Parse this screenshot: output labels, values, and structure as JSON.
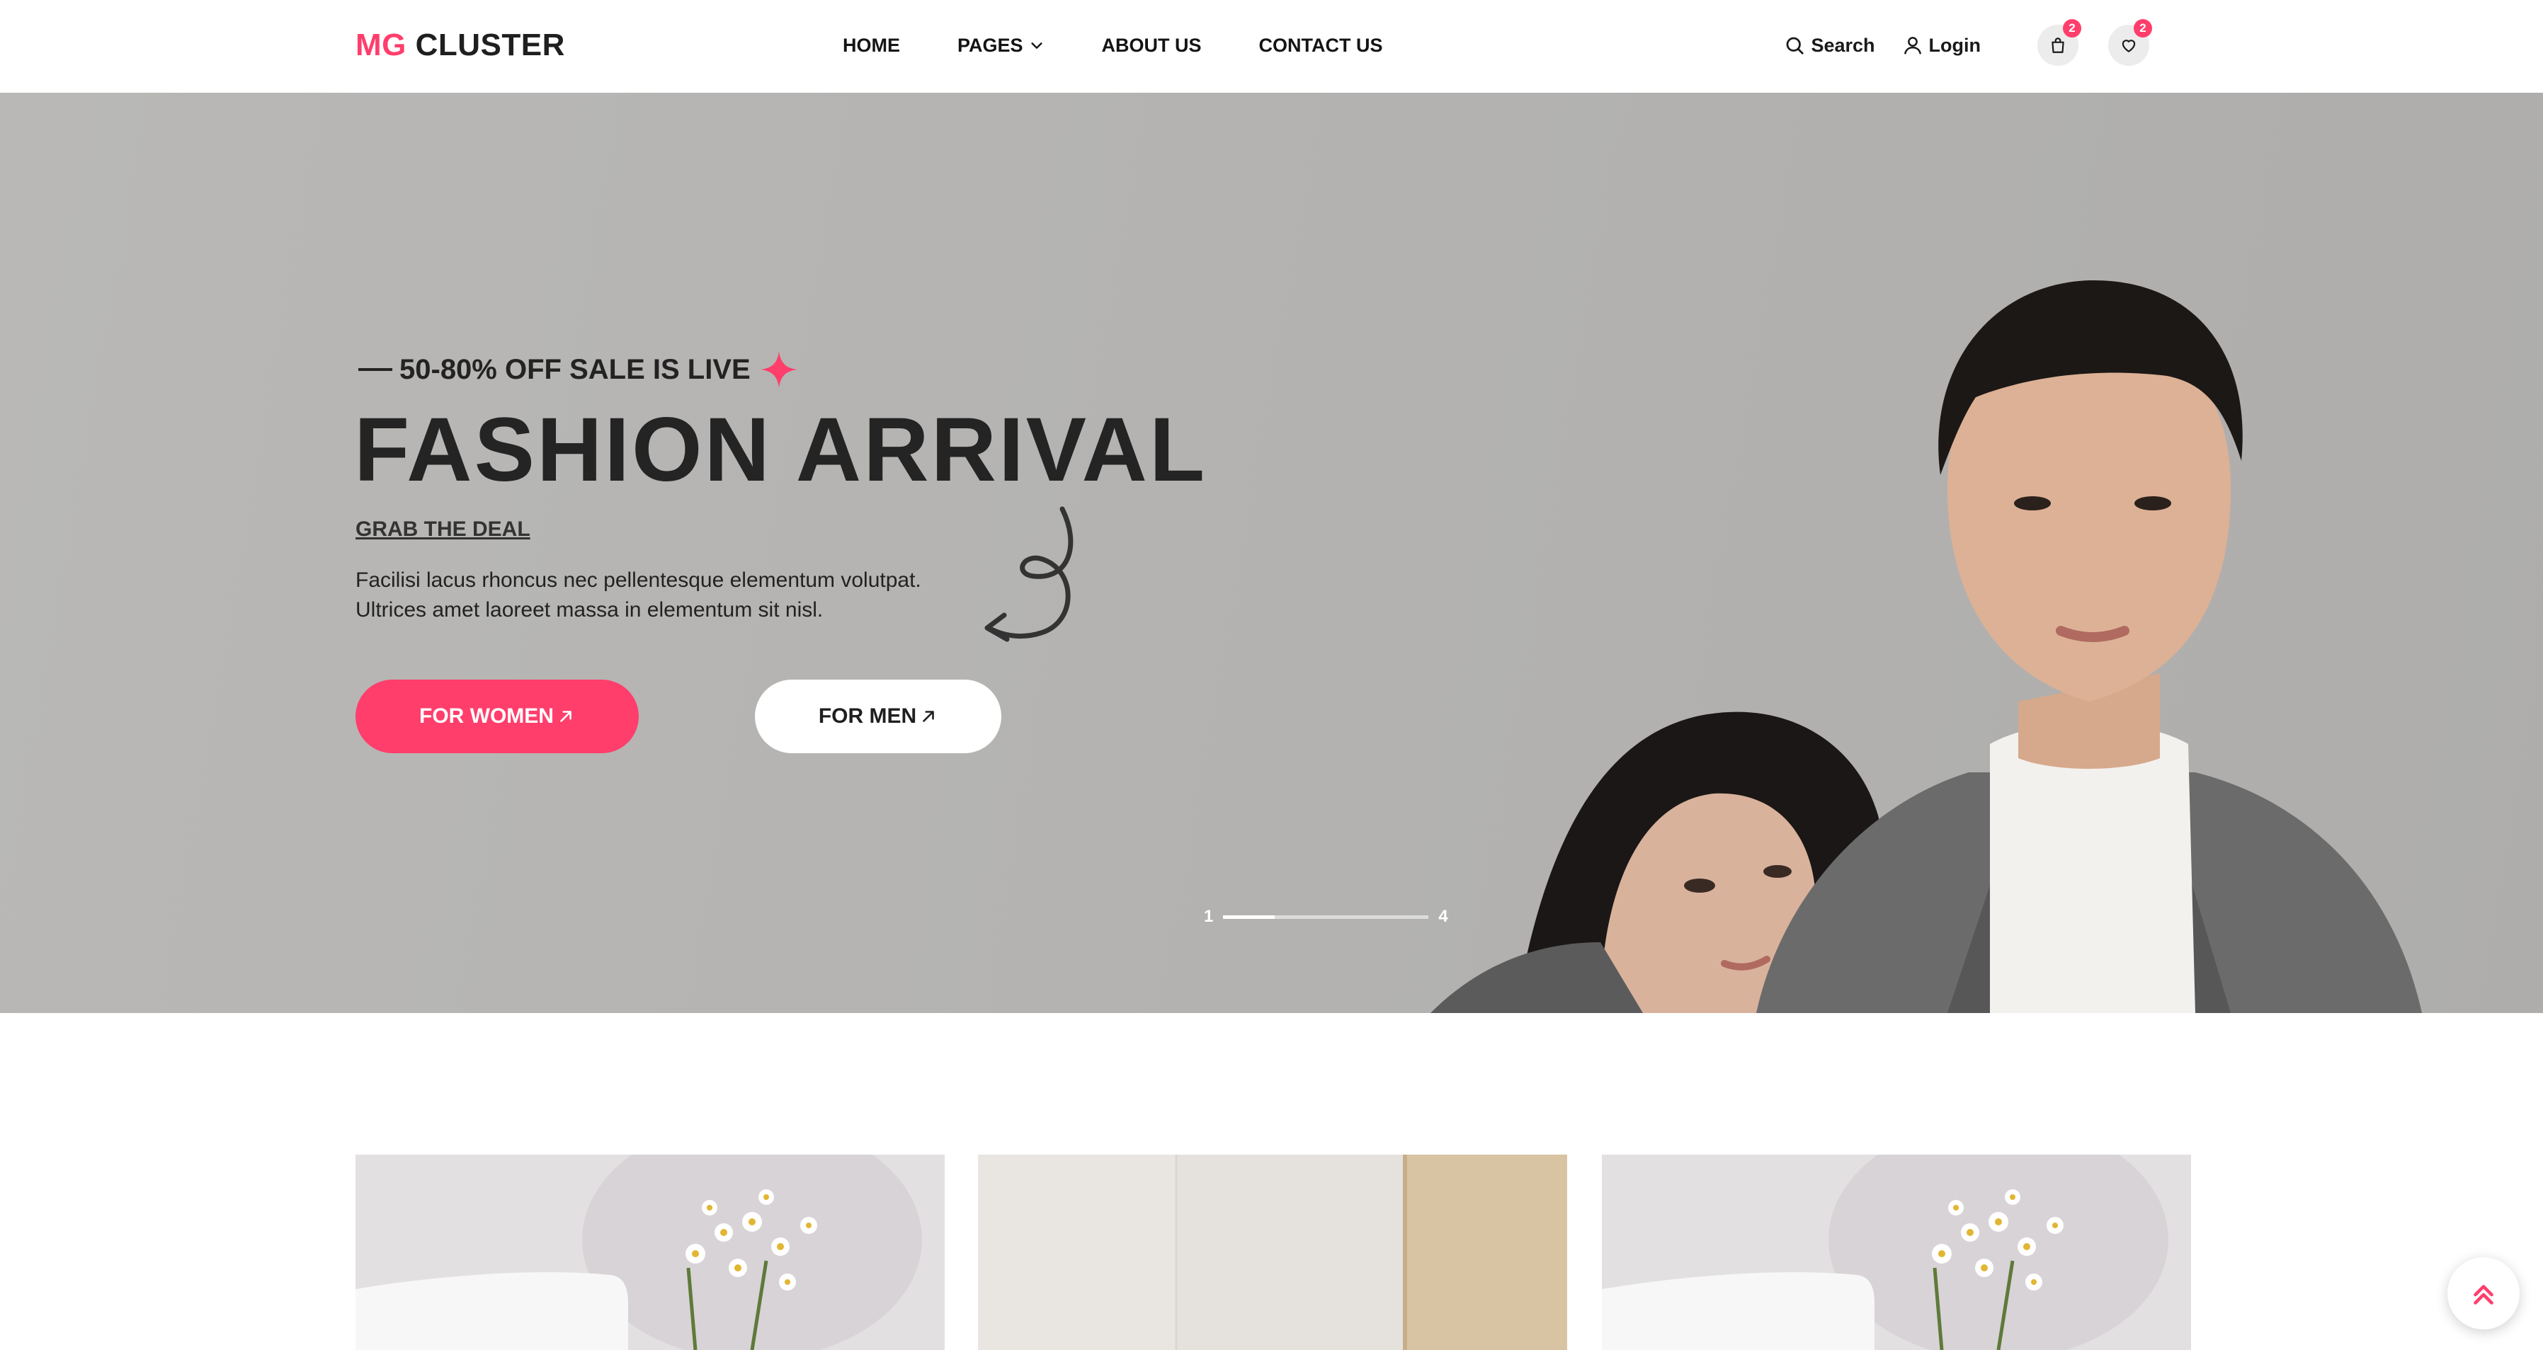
{
  "brand": {
    "logo_accent": "MG",
    "logo_rest": " CLUSTER",
    "accent_color": "#ff3e6c"
  },
  "nav": {
    "items": [
      {
        "label": "HOME"
      },
      {
        "label": "PAGES",
        "has_dropdown": true
      },
      {
        "label": "ABOUT US"
      },
      {
        "label": "CONTACT US"
      }
    ]
  },
  "utility": {
    "search_label": "Search",
    "login_label": "Login",
    "cart_count": "2",
    "wishlist_count": "2",
    "icons": [
      "search-icon",
      "user-icon",
      "shopping-bag-icon",
      "heart-icon"
    ]
  },
  "hero": {
    "eyebrow": "50-80% OFF SALE IS LIVE",
    "title": "FASHION ARRIVAL",
    "link_label": "GRAB THE DEAL",
    "description": "Facilisi lacus rhoncus nec pellentesque elementum volutpat. Ultrices amet laoreet massa in elementum sit nisl.",
    "button_women": "FOR WOMEN",
    "button_men": "FOR MEN",
    "slider": {
      "current": "1",
      "total": "4",
      "progress": 0.25
    }
  },
  "cards": [
    {
      "icon": "flowers-laptop-image"
    },
    {
      "icon": "interior-image"
    },
    {
      "icon": "flowers-laptop-image"
    }
  ],
  "scroll_top_icon": "double-chevron-up-icon"
}
